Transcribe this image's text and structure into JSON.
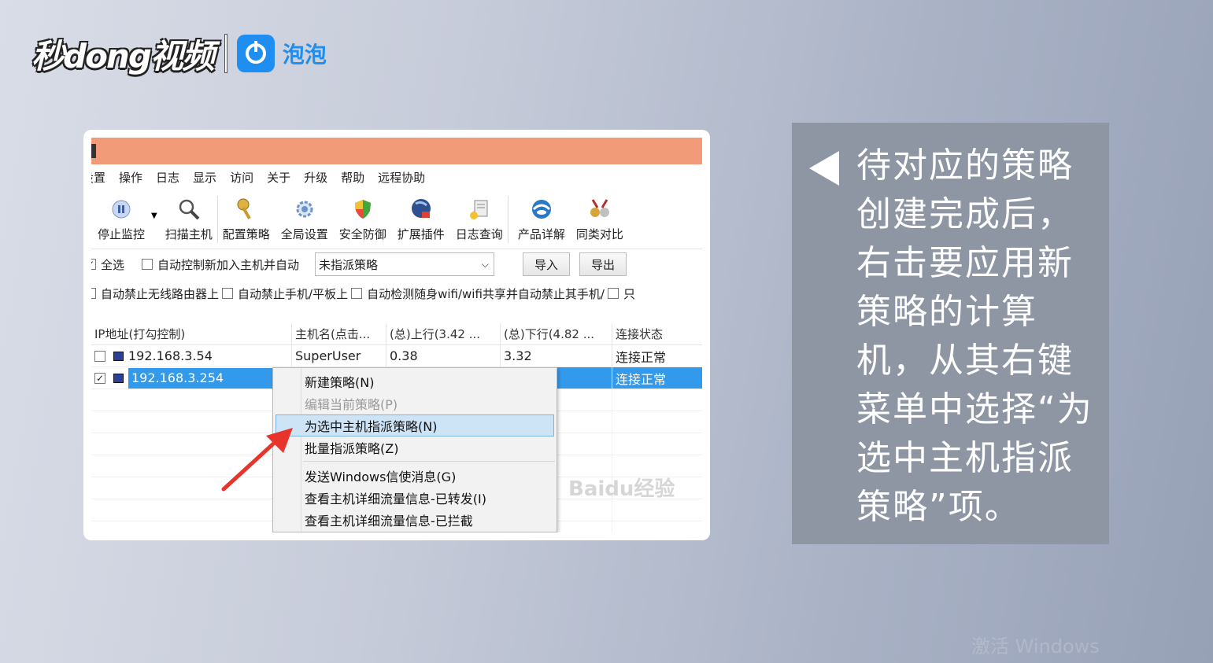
{
  "brand": {
    "name": "秒dong视频",
    "sub_name": "泡泡"
  },
  "app": {
    "menu": [
      "设置",
      "操作",
      "日志",
      "显示",
      "访问",
      "关于",
      "升级",
      "帮助",
      "远程协助"
    ],
    "toolbar": [
      {
        "label": "停止监控",
        "icon": "pause-icon"
      },
      {
        "label": "扫描主机",
        "icon": "magnifier-icon"
      },
      {
        "label": "配置策略",
        "icon": "key-icon"
      },
      {
        "label": "全局设置",
        "icon": "gear-icon"
      },
      {
        "label": "安全防御",
        "icon": "shield-icon"
      },
      {
        "label": "扩展插件",
        "icon": "plugin-icon"
      },
      {
        "label": "日志查询",
        "icon": "log-icon"
      },
      {
        "label": "产品详解",
        "icon": "globe-icon"
      },
      {
        "label": "同类对比",
        "icon": "medal-icon"
      }
    ],
    "options_row1": {
      "select_all": "全选",
      "auto_control": "自动控制新加入主机并自动",
      "policy_select": "未指派策略",
      "import_button": "导入",
      "export_button": "导出"
    },
    "options_row2": {
      "opt1": "自动禁止无线路由器上",
      "opt2": "自动禁止手机/平板上",
      "opt3": "自动检测随身wifi/wifi共享并自动禁止其手机/",
      "opt4": "只"
    },
    "table": {
      "headers": [
        "IP地址(打勾控制)",
        "主机名(点击...",
        "(总)上行(3.42 ...",
        "(总)下行(4.82 ...",
        "连接状态"
      ],
      "rows": [
        {
          "checked": false,
          "ip": "192.168.3.54",
          "host": "SuperUser",
          "up": "0.38",
          "down": "3.32",
          "status": "连接正常",
          "selected": false
        },
        {
          "checked": true,
          "ip": "192.168.3.254",
          "host": "",
          "up": "",
          "down": "",
          "status": "连接正常",
          "selected": true
        }
      ]
    },
    "context_menu": [
      {
        "label": "新建策略(N)",
        "disabled": false,
        "highlighted": false
      },
      {
        "label": "编辑当前策略(P)",
        "disabled": true,
        "highlighted": false
      },
      {
        "label": "为选中主机指派策略(N)",
        "disabled": false,
        "highlighted": true
      },
      {
        "label": "批量指派策略(Z)",
        "disabled": false,
        "highlighted": false
      },
      {
        "label": "发送Windows信使消息(G)",
        "disabled": false,
        "highlighted": false
      },
      {
        "label": "查看主机详细流量信息-已转发(I)",
        "disabled": false,
        "highlighted": false
      },
      {
        "label": "查看主机详细流量信息-已拦截",
        "disabled": false,
        "highlighted": false
      }
    ],
    "watermark": "Baidu经验"
  },
  "caption": {
    "text": "待对应的策略创建完成后，右击要应用新策略的计算机，从其右键菜单中选择“为选中主机指派策略”项。"
  },
  "os_watermark": "激活 Windows",
  "colors": {
    "titlebar": "#f19b78",
    "selection": "#3399ea",
    "menu_highlight": "#cde4f7",
    "caption_panel": "#8e95a3",
    "brand_blue": "#1e8ff0",
    "arrow": "#e8352b"
  }
}
